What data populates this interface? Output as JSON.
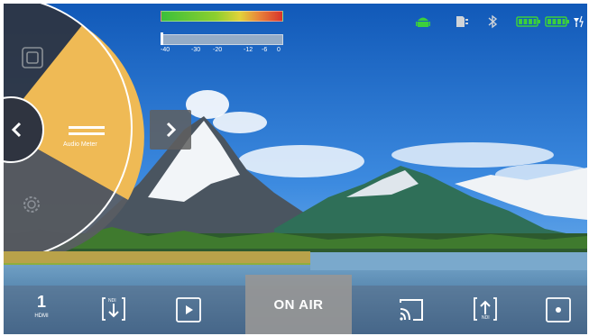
{
  "audio_meter": {
    "scale": [
      "-40",
      "-30",
      "-20",
      "-12",
      "-6",
      "0"
    ]
  },
  "status_icons": [
    "android-icon",
    "sd-card-icon",
    "bluetooth-icon",
    "battery-icon",
    "battery-icon",
    "charging-icon"
  ],
  "side_menu": {
    "selected_label": "Audio Meter",
    "items": [
      "screen-icon",
      "audio-meter-icon",
      "settings-icon"
    ]
  },
  "toolbar": {
    "input_number": "1",
    "input_type": "HDMI",
    "ndi_in_label": "NDI",
    "ndi_out_label": "NDI",
    "on_air_label": "ON AIR"
  },
  "colors": {
    "accent": "#efba55",
    "status_green": "#3ccf3c",
    "panel_dark": "#2f3440"
  }
}
